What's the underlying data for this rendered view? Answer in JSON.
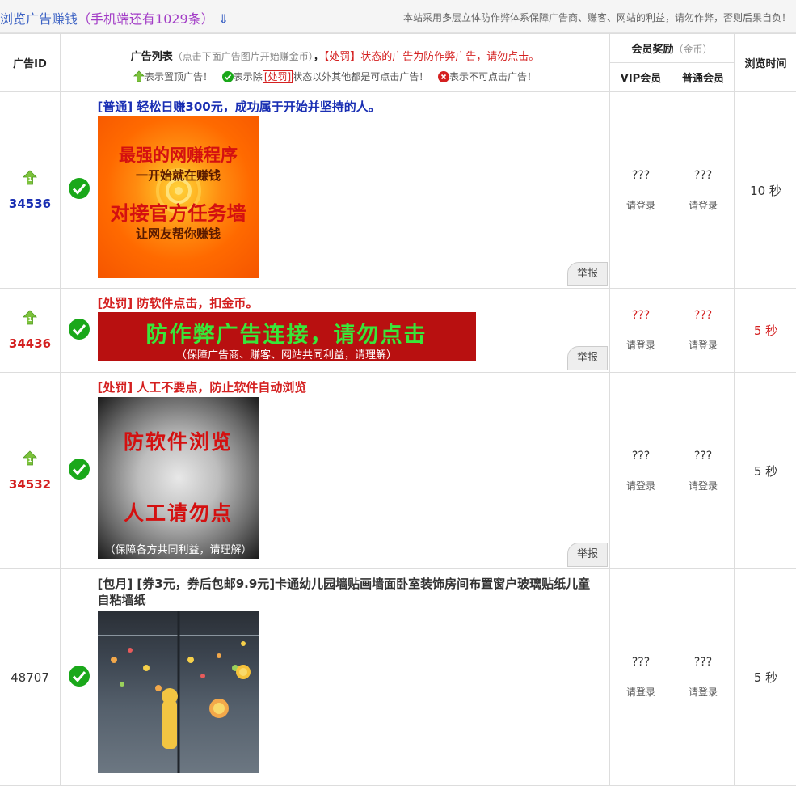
{
  "header": {
    "title": "浏览广告赚钱",
    "subtitle": "（手机端还有1029条）",
    "arrow": "⇓",
    "notice": "本站采用多层立体防作弊体系保障广告商、赚客、网站的利益，请勿作弊，否则后果自负！"
  },
  "table_head": {
    "col_id": "广告ID",
    "col_list": "广告列表",
    "col_list_hint": "（点击下面广告图片开始赚金币）",
    "comma": "，",
    "penalty_note": "【处罚】状态的广告为防作弊广告，请勿点击。",
    "legend": {
      "top": "表示置顶广告！",
      "clickable_prefix": "表示除",
      "clickable_tag": "[处罚]",
      "clickable_suffix": "状态以外其他都是可点击广告！",
      "not_clickable": "表示不可点击广告！"
    },
    "col_reward": "会员奖励",
    "col_reward_unit": "（金币）",
    "col_vip": "VIP会员",
    "col_normal": "普通会员",
    "col_time": "浏览时间"
  },
  "rows": [
    {
      "id": "34536",
      "title": "[普通]  轻松日赚300元，成功属于开始并坚持的人。",
      "banner": {
        "line1": "最强的网赚程序",
        "line2": "一开始就在赚钱",
        "line3": "对接官方任务墙",
        "line4": "让网友帮你赚钱"
      },
      "report": "举报",
      "vip": "???",
      "normal": "???",
      "login": "请登录",
      "time": "10 秒"
    },
    {
      "id": "34436",
      "title": "[处罚]  防软件点击，扣金币。",
      "banner": {
        "line1": "防作弊广告连接，请勿点击",
        "line2": "（保障广告商、赚客、网站共同利益，请理解）"
      },
      "report": "举报",
      "vip": "???",
      "normal": "???",
      "login": "请登录",
      "time": "5 秒"
    },
    {
      "id": "34532",
      "title": "[处罚]  人工不要点，防止软件自动浏览",
      "banner": {
        "line1": "防软件浏览",
        "line2": "人工请勿点",
        "line3": "（保障各方共同利益，请理解）"
      },
      "report": "举报",
      "vip": "???",
      "normal": "???",
      "login": "请登录",
      "time": "5 秒"
    },
    {
      "id": "48707",
      "title": "[包月]  [券3元，券后包邮9.9元]卡通幼儿园墙贴画墙面卧室装饰房间布置窗户玻璃贴纸儿童自粘墙纸",
      "vip": "???",
      "normal": "???",
      "login": "请登录",
      "time": "5 秒"
    }
  ],
  "colors": {
    "blue": "#1a2fb3",
    "red": "#d42020",
    "green": "#1aa81a"
  }
}
